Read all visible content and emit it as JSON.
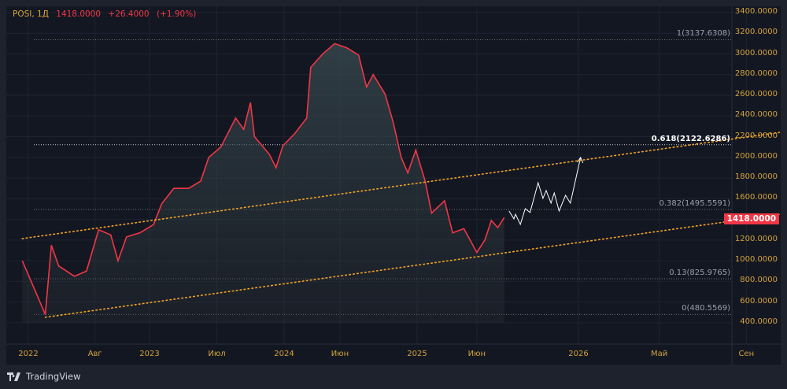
{
  "header": {
    "symbol": "POSI, 1Д",
    "price": "1418.0000",
    "change": "+26.4000",
    "change_pct": "(+1.90%)"
  },
  "last_price_badge": "1418.0000",
  "brand": "TradingView",
  "colors": {
    "price_line": "#f23645",
    "projection": "#ffffff",
    "channel": "#f5a623",
    "axis_text": "#d4a33a"
  },
  "chart_data": {
    "type": "line",
    "y_ticks": [
      "3400.0000",
      "3200.0000",
      "3000.0000",
      "2800.0000",
      "2600.0000",
      "2400.0000",
      "2200.0000",
      "2000.0000",
      "1800.0000",
      "1600.0000",
      "1400.0000",
      "1200.0000",
      "1000.0000",
      "800.0000",
      "600.0000",
      "400.0000"
    ],
    "y_tick_values": [
      3400,
      3200,
      3000,
      2800,
      2600,
      2400,
      2200,
      2000,
      1800,
      1600,
      1400,
      1200,
      1000,
      800,
      600,
      400
    ],
    "ylim": [
      400,
      3400
    ],
    "x_ticks": [
      {
        "label": "2022",
        "t": 2022.0
      },
      {
        "label": "Авг",
        "t": 2022.55
      },
      {
        "label": "2023",
        "t": 2023.0
      },
      {
        "label": "Июл",
        "t": 2023.5
      },
      {
        "label": "2024",
        "t": 2024.0
      },
      {
        "label": "Июн",
        "t": 2024.42
      },
      {
        "label": "2025",
        "t": 2025.0
      },
      {
        "label": "Июн",
        "t": 2025.37
      },
      {
        "label": "2026",
        "t": 2026.0
      },
      {
        "label": "Май",
        "t": 2026.38
      },
      {
        "label": "Сен",
        "t": 2026.79
      }
    ],
    "series": [
      {
        "name": "POSI",
        "points": [
          [
            2021.95,
            1000
          ],
          [
            2022.06,
            700
          ],
          [
            2022.14,
            480
          ],
          [
            2022.19,
            1150
          ],
          [
            2022.25,
            950
          ],
          [
            2022.38,
            850
          ],
          [
            2022.48,
            900
          ],
          [
            2022.58,
            1300
          ],
          [
            2022.68,
            1250
          ],
          [
            2022.74,
            1000
          ],
          [
            2022.81,
            1230
          ],
          [
            2022.92,
            1270
          ],
          [
            2023.03,
            1350
          ],
          [
            2023.09,
            1550
          ],
          [
            2023.18,
            1700
          ],
          [
            2023.29,
            1700
          ],
          [
            2023.38,
            1770
          ],
          [
            2023.44,
            2000
          ],
          [
            2023.53,
            2100
          ],
          [
            2023.64,
            2380
          ],
          [
            2023.7,
            2270
          ],
          [
            2023.75,
            2530
          ],
          [
            2023.78,
            2200
          ],
          [
            2023.89,
            2030
          ],
          [
            2023.94,
            1900
          ],
          [
            2023.99,
            2110
          ],
          [
            2024.08,
            2230
          ],
          [
            2024.17,
            2380
          ],
          [
            2024.2,
            2870
          ],
          [
            2024.29,
            3000
          ],
          [
            2024.38,
            3100
          ],
          [
            2024.47,
            3060
          ],
          [
            2024.56,
            2990
          ],
          [
            2024.62,
            2680
          ],
          [
            2024.67,
            2800
          ],
          [
            2024.76,
            2610
          ],
          [
            2024.82,
            2340
          ],
          [
            2024.88,
            2000
          ],
          [
            2024.93,
            1850
          ],
          [
            2024.99,
            2070
          ],
          [
            2025.05,
            1770
          ],
          [
            2025.09,
            1460
          ],
          [
            2025.17,
            1580
          ],
          [
            2025.22,
            1270
          ],
          [
            2025.29,
            1310
          ],
          [
            2025.37,
            1080
          ],
          [
            2025.42,
            1200
          ],
          [
            2025.46,
            1390
          ],
          [
            2025.5,
            1320
          ],
          [
            2025.54,
            1418
          ]
        ]
      },
      {
        "name": "projection",
        "points": [
          [
            2025.57,
            1481
          ],
          [
            2025.6,
            1405
          ],
          [
            2025.61,
            1450
          ],
          [
            2025.64,
            1351
          ],
          [
            2025.67,
            1504
          ],
          [
            2025.7,
            1466
          ],
          [
            2025.75,
            1755
          ],
          [
            2025.78,
            1603
          ],
          [
            2025.8,
            1679
          ],
          [
            2025.83,
            1557
          ],
          [
            2025.85,
            1656
          ],
          [
            2025.88,
            1481
          ],
          [
            2025.92,
            1633
          ],
          [
            2025.95,
            1557
          ],
          [
            2026.01,
            1999
          ]
        ]
      }
    ],
    "channel": [
      {
        "name": "upper",
        "from": [
          2021.95,
          1214
        ],
        "to": [
          2026.95,
          2242
        ]
      },
      {
        "name": "lower",
        "from": [
          2022.14,
          453
        ],
        "to": [
          2026.95,
          1450
        ]
      }
    ],
    "fib_levels": [
      {
        "label": "1(3137.6308)",
        "value": 3137.6308
      },
      {
        "label": "0.618(2122.6286)",
        "value": 2122.6286,
        "highlight": true
      },
      {
        "label": "0.382(1495.5591)",
        "value": 1495.5591
      },
      {
        "label": "0.13(825.9765)",
        "value": 825.9765
      },
      {
        "label": "0(480.5569)",
        "value": 480.5569
      }
    ]
  }
}
